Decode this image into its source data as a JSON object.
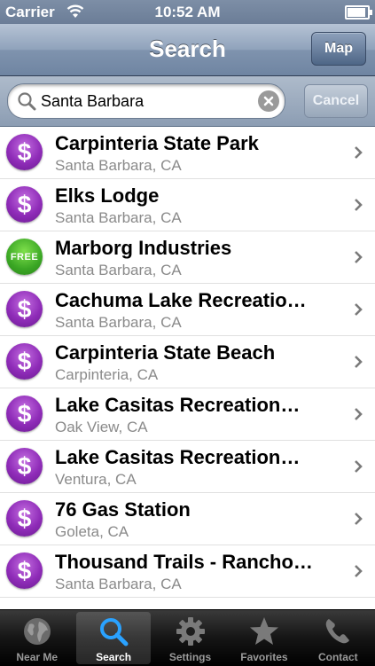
{
  "status_bar": {
    "carrier": "Carrier",
    "time": "10:52 AM",
    "battery_level": 0.9
  },
  "nav": {
    "title": "Search",
    "map_label": "Map"
  },
  "search": {
    "value": "Santa Barbara",
    "cancel_label": "Cancel"
  },
  "results": [
    {
      "badge": "$",
      "badge_type": "paid",
      "title": "Carpinteria State Park",
      "subtitle": "Santa Barbara, CA"
    },
    {
      "badge": "$",
      "badge_type": "paid",
      "title": "Elks Lodge",
      "subtitle": "Santa Barbara, CA"
    },
    {
      "badge": "FREE",
      "badge_type": "free",
      "title": "Marborg Industries",
      "subtitle": "Santa Barbara, CA"
    },
    {
      "badge": "$",
      "badge_type": "paid",
      "title": "Cachuma Lake Recreatio…",
      "subtitle": "Santa Barbara, CA"
    },
    {
      "badge": "$",
      "badge_type": "paid",
      "title": "Carpinteria State Beach",
      "subtitle": "Carpinteria, CA"
    },
    {
      "badge": "$",
      "badge_type": "paid",
      "title": "Lake Casitas Recreation…",
      "subtitle": "Oak View, CA"
    },
    {
      "badge": "$",
      "badge_type": "paid",
      "title": "Lake Casitas Recreation…",
      "subtitle": "Ventura, CA"
    },
    {
      "badge": "$",
      "badge_type": "paid",
      "title": "76 Gas Station",
      "subtitle": "Goleta, CA"
    },
    {
      "badge": "$",
      "badge_type": "paid",
      "title": "Thousand Trails - Rancho…",
      "subtitle": "Santa Barbara, CA"
    }
  ],
  "tabs": [
    {
      "label": "Near Me",
      "icon": "globe-icon",
      "selected": false
    },
    {
      "label": "Search",
      "icon": "search-icon",
      "selected": true
    },
    {
      "label": "Settings",
      "icon": "gear-icon",
      "selected": false
    },
    {
      "label": "Favorites",
      "icon": "star-icon",
      "selected": false
    },
    {
      "label": "Contact",
      "icon": "phone-icon",
      "selected": false
    }
  ],
  "colors": {
    "paid_badge": "#8f2cb8",
    "free_badge": "#3aa624",
    "nav_bar": "#7f93ae",
    "tab_bar": "#151515"
  }
}
